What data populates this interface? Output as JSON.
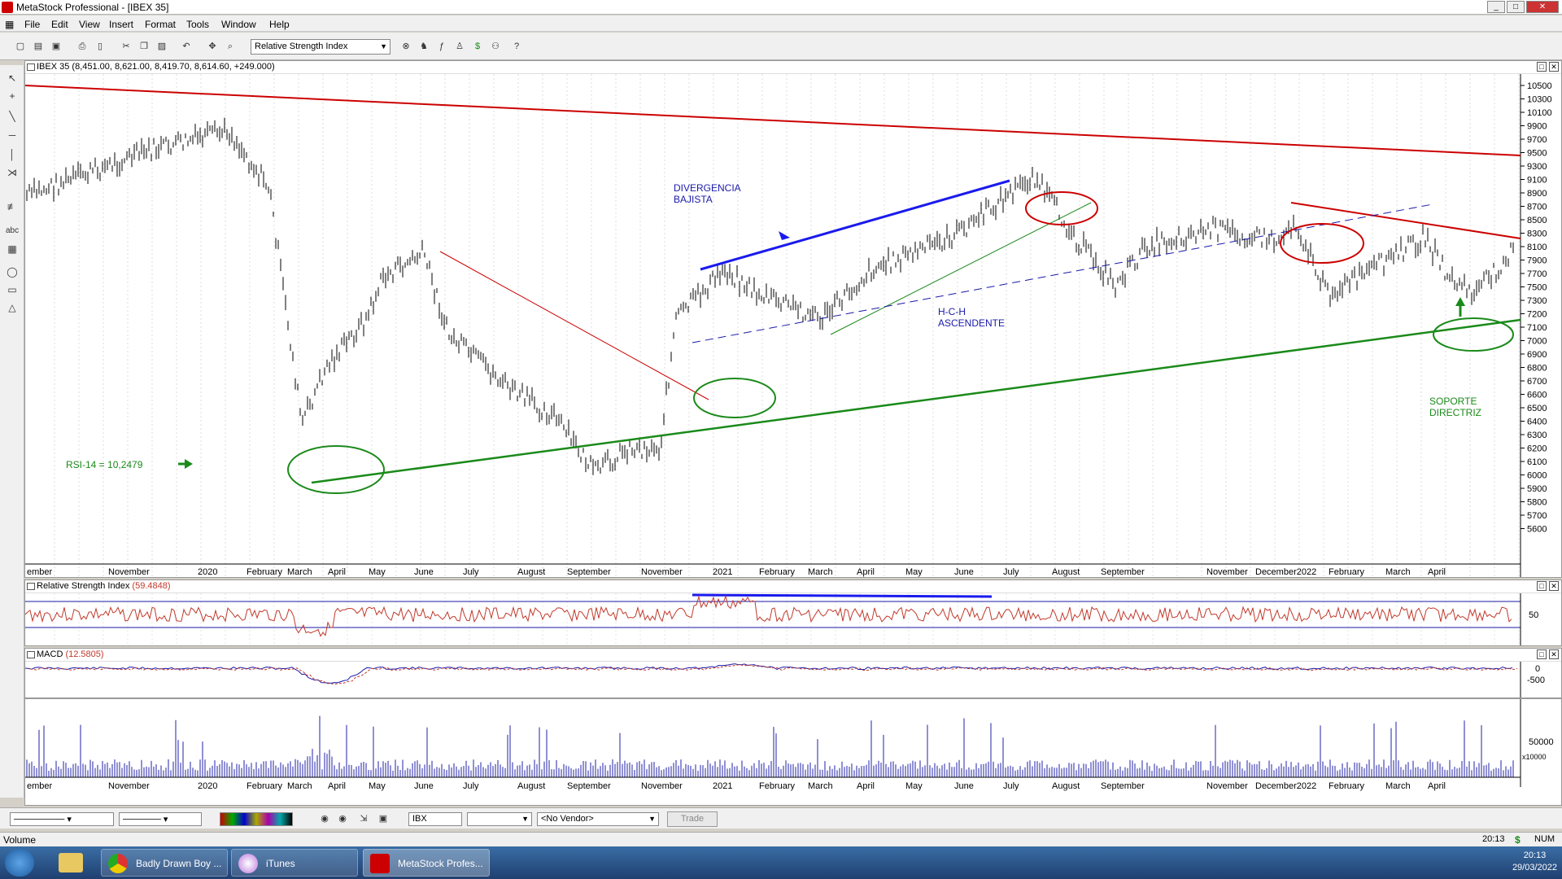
{
  "window": {
    "title": "MetaStock Professional - [IBEX 35]"
  },
  "menu": [
    "File",
    "Edit",
    "View",
    "Insert",
    "Format",
    "Tools",
    "Window",
    "Help"
  ],
  "toolbar": {
    "indicator_select": "Relative Strength Index"
  },
  "price_pane": {
    "header": "IBEX 35 (8,451.00, 8,621.00, 8,419.70, 8,614.60, +249.000)",
    "y_ticks": [
      "10500",
      "10300",
      "10100",
      "9900",
      "9700",
      "9500",
      "9300",
      "9100",
      "8900",
      "8700",
      "8500",
      "8300",
      "8100",
      "7900",
      "7700",
      "7500",
      "7300",
      "7200",
      "7100",
      "7000",
      "6900",
      "6800",
      "6700",
      "6600",
      "6500",
      "6400",
      "6300",
      "6200",
      "6100",
      "6000",
      "5900",
      "5800",
      "5700",
      "5600"
    ],
    "annotations": {
      "divergencia_1": "DIVERGENCIA",
      "divergencia_2": "BAJISTA",
      "hch_1": "H-C-H",
      "hch_2": "ASCENDENTE",
      "soporte_1": "SOPORTE",
      "soporte_2": "DIRECTRIZ",
      "rsi_note": "RSI-14 = 10,2479"
    }
  },
  "rsi_pane": {
    "label": "Relative Strength Index",
    "value": "(59.4848)",
    "y_tick": "50"
  },
  "macd_pane": {
    "label": "MACD",
    "value": "(12.5805)",
    "y_ticks": [
      "0",
      "-500"
    ]
  },
  "volume_pane": {
    "y_tick": "50000",
    "multiplier": "x10000"
  },
  "x_axis": {
    "labels": [
      "ember",
      "November",
      "2020",
      "February",
      "March",
      "April",
      "May",
      "June",
      "July",
      "August",
      "September",
      "November",
      "2021",
      "February",
      "March",
      "April",
      "May",
      "June",
      "July",
      "August",
      "September",
      "November",
      "December2022",
      "February",
      "March",
      "April"
    ]
  },
  "bottom": {
    "symbol": "IBX",
    "vendor": "<No Vendor>",
    "trade": "Trade"
  },
  "status": {
    "left": "Volume",
    "time": "20:13",
    "num": "NUM"
  },
  "taskbar": {
    "items": [
      "Badly Drawn Boy ...",
      "iTunes",
      "MetaStock Profes..."
    ],
    "clock_time": "20:13",
    "clock_date": "29/03/2022"
  },
  "colors": {
    "price_bars": "#000000",
    "resistance_line": "#cc0000",
    "support_line": "#1a8a1a",
    "annotation_blue": "#1a1aaa",
    "rsi_line": "#c0392b"
  }
}
